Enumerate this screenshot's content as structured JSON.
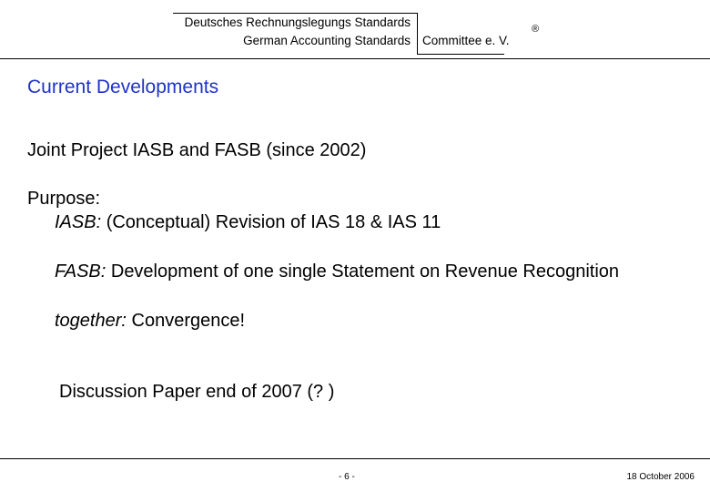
{
  "header": {
    "org_name_de": "Deutsches Rechnungslegungs Standards",
    "org_name_en": "German Accounting Standards",
    "committee": "Committee e. V.",
    "registered_mark": "®"
  },
  "slide": {
    "title": "Current Developments",
    "subtitle": "Joint Project IASB and FASB (since 2002)",
    "purpose_label": "Purpose",
    "purpose_colon": ":",
    "iasb_label": "IASB:",
    "iasb_text": " (Conceptual) Revision of IAS 18 & IAS 11",
    "fasb_label": "FASB:",
    "fasb_text": " Development of one single Statement on Revenue Recognition",
    "together_label": "together:",
    "together_text": " Convergence!",
    "discussion": "Discussion Paper end of 2007 (? )"
  },
  "footer": {
    "page_number": "- 6 -",
    "date": "18 October 2006"
  }
}
